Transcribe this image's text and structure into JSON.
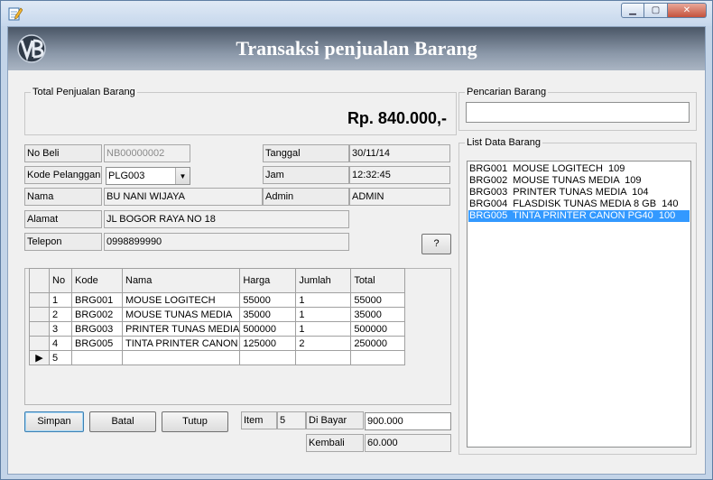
{
  "header": {
    "title": "Transaksi penjualan Barang"
  },
  "total_group": {
    "legend": "Total Penjualan Barang",
    "amount": "Rp. 840.000,-"
  },
  "form": {
    "no_beli": {
      "label": "No Beli",
      "value": "NB00000002"
    },
    "kode_pelanggan": {
      "label": "Kode Pelanggan",
      "value": "PLG003"
    },
    "nama": {
      "label": "Nama",
      "value": "BU NANI WIJAYA"
    },
    "alamat": {
      "label": "Alamat",
      "value": "JL BOGOR RAYA NO 18"
    },
    "telepon": {
      "label": "Telepon",
      "value": "0998899990"
    },
    "tanggal": {
      "label": "Tanggal",
      "value": "30/11/14"
    },
    "jam": {
      "label": "Jam",
      "value": "12:32:45"
    },
    "admin": {
      "label": "Admin",
      "value": "ADMIN"
    },
    "help_button": "?"
  },
  "grid": {
    "columns": [
      "No",
      "Kode",
      "Nama",
      "Harga",
      "Jumlah",
      "Total"
    ],
    "rows": [
      [
        "1",
        "BRG001",
        "MOUSE LOGITECH",
        "55000",
        "1",
        "55000"
      ],
      [
        "2",
        "BRG002",
        "MOUSE TUNAS MEDIA",
        "35000",
        "1",
        "35000"
      ],
      [
        "3",
        "BRG003",
        "PRINTER TUNAS MEDIA",
        "500000",
        "1",
        "500000"
      ],
      [
        "4",
        "BRG005",
        "TINTA PRINTER CANON",
        "125000",
        "2",
        "250000"
      ],
      [
        "5",
        "",
        "",
        "",
        "",
        ""
      ]
    ],
    "current_row_marker": "▶"
  },
  "buttons": {
    "simpan": "Simpan",
    "batal": "Batal",
    "tutup": "Tutup"
  },
  "summary": {
    "item_label": "Item",
    "item_value": "5",
    "dibayar_label": "Di Bayar",
    "dibayar_value": "900.000",
    "kembali_label": "Kembali",
    "kembali_value": "60.000"
  },
  "search": {
    "legend": "Pencarian Barang",
    "value": ""
  },
  "list": {
    "legend": "List Data Barang",
    "items": [
      "BRG001  MOUSE LOGITECH  109",
      "BRG002  MOUSE TUNAS MEDIA  109",
      "BRG003  PRINTER TUNAS MEDIA  104",
      "BRG004  FLASDISK TUNAS MEDIA 8 GB  140",
      "BRG005  TINTA PRINTER CANON PG40  100"
    ],
    "selected_index": 4
  },
  "colors": {
    "selection": "#3399ff",
    "header_dark": "#4a5666"
  }
}
